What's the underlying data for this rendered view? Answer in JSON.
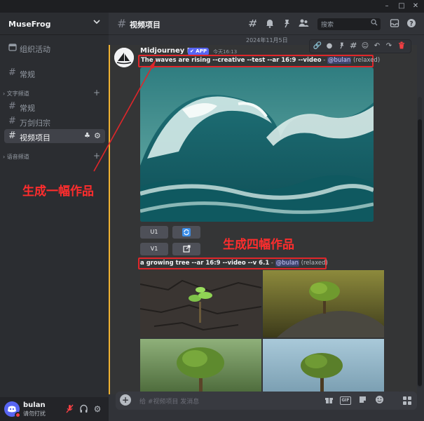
{
  "window": {
    "minimize": "–",
    "maximize": "□",
    "close": "✕"
  },
  "server": {
    "name": "MuseFrog"
  },
  "sidebar": {
    "events_label": "组织活动",
    "top_channel": "常规",
    "categories": [
      {
        "label": "文字频道",
        "channels": [
          "常规",
          "万剑归宗",
          "视频项目"
        ]
      },
      {
        "label": "语音频道"
      }
    ]
  },
  "user": {
    "name": "bulan",
    "status": "请勿打扰"
  },
  "header": {
    "channel": "视频项目",
    "search_placeholder": "搜索"
  },
  "date_divider": "2024年11月5日",
  "message": {
    "author": "Midjourney Bot",
    "badge": "✔ APP",
    "time": "今天16:13",
    "prompt1": {
      "text": "The waves are rising --creative --test --ar 16:9 --video",
      "sep": " - ",
      "mention": "@bulan",
      "mode": " (relaxed)"
    },
    "buttons": {
      "u1": "U1",
      "v1": "V1"
    },
    "prompt2": {
      "text": "a growing tree --ar 16:9 --video --v 6.1",
      "sep": " - ",
      "mention": "@bulan",
      "mode": " (relaxed)"
    }
  },
  "chat_input": {
    "placeholder": "给 #视频项目 发消息"
  },
  "annotations": {
    "one": "生成一幅作品",
    "four": "生成四幅作品"
  },
  "colors": {
    "accent": "#5865f2",
    "annotation": "#ff2d2d",
    "highlight_stripe": "#f0b232"
  }
}
